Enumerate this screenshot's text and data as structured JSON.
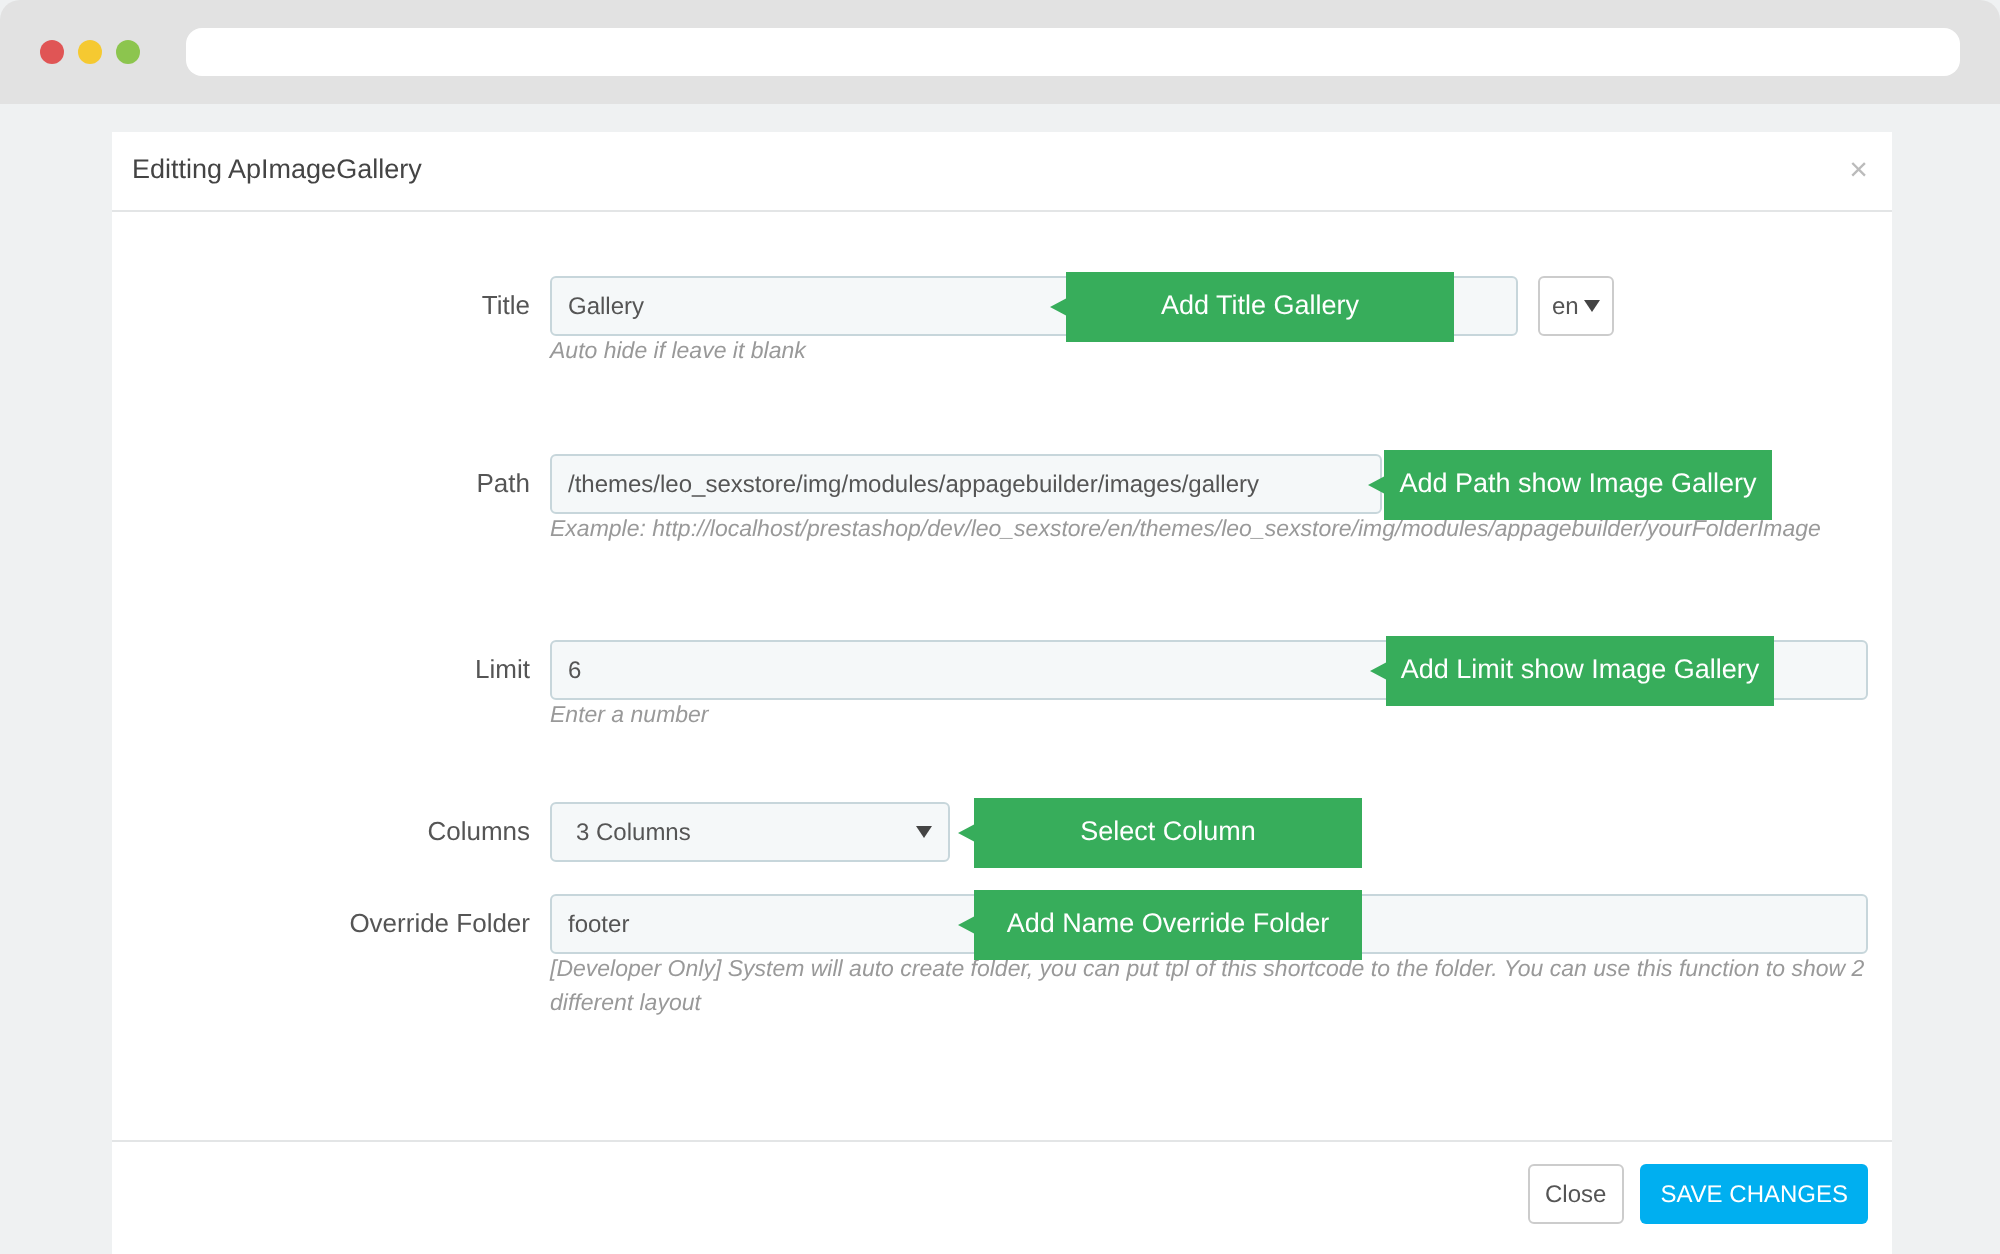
{
  "modal": {
    "title": "Editting ApImageGallery",
    "close": "×"
  },
  "fields": [
    {
      "kind": "text",
      "label": "Title",
      "value": "Gallery",
      "help": "Auto hide if leave it blank",
      "tooltip": "Add Title Gallery",
      "language": "en"
    },
    {
      "kind": "text",
      "label": "Path",
      "value": "/themes/leo_sexstore/img/modules/appagebuilder/images/gallery",
      "help": "Example: http://localhost/prestashop/dev/leo_sexstore/en/themes/leo_sexstore/img/modules/appagebuilder/yourFolderImage",
      "tooltip": "Add Path show Image Gallery"
    },
    {
      "kind": "text",
      "label": "Limit",
      "value": "6",
      "help": "Enter a number",
      "tooltip": "Add Limit show Image Gallery"
    },
    {
      "kind": "select",
      "label": "Columns",
      "value": "3 Columns",
      "tooltip": "Select Column"
    },
    {
      "kind": "text",
      "label": "Override Folder",
      "value": "footer",
      "help": "[Developer Only] System will auto create folder, you can put tpl of this shortcode to the folder. You can use this function to show 2 different layout",
      "tooltip": "Add Name Override Folder"
    }
  ],
  "buttons": [
    {
      "kind": "secondary",
      "label": "Close"
    },
    {
      "kind": "primary",
      "label": "SAVE CHANGES"
    }
  ]
}
